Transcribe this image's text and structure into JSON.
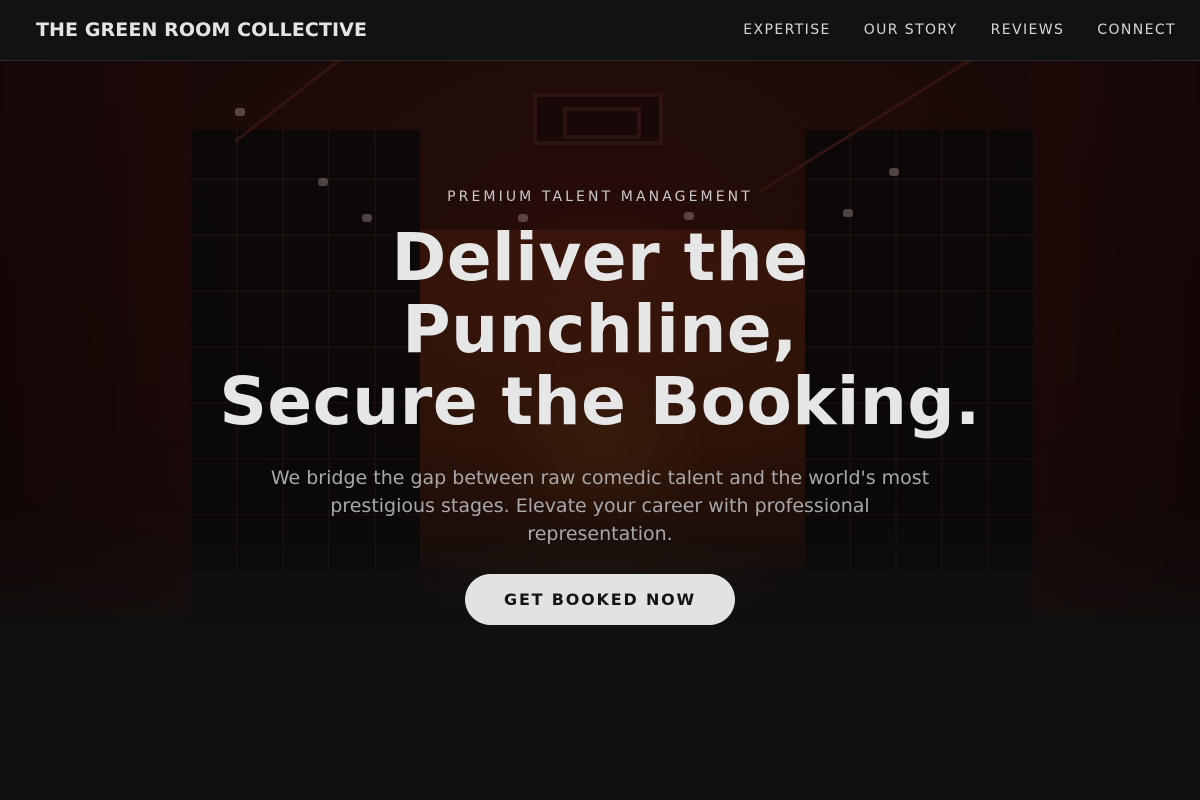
{
  "header": {
    "brand": "THE GREEN ROOM COLLECTIVE",
    "nav": [
      {
        "label": "EXPERTISE"
      },
      {
        "label": "OUR STORY"
      },
      {
        "label": "REVIEWS"
      },
      {
        "label": "CONNECT"
      }
    ]
  },
  "hero": {
    "eyebrow": "PREMIUM TALENT MANAGEMENT",
    "headline_lines": [
      "Deliver the",
      "Punchline,",
      "Secure the Booking."
    ],
    "subtext": "We bridge the gap between raw comedic talent and the world's most prestigious stages. Elevate your career with professional representation.",
    "cta_label": "GET BOOKED NOW"
  },
  "colors": {
    "background": "#111111",
    "header_background": "#121212",
    "text_primary": "#e6e6e6",
    "text_muted": "#a8a8ab",
    "cta_background": "#e2e2e2",
    "cta_text": "#141414"
  }
}
